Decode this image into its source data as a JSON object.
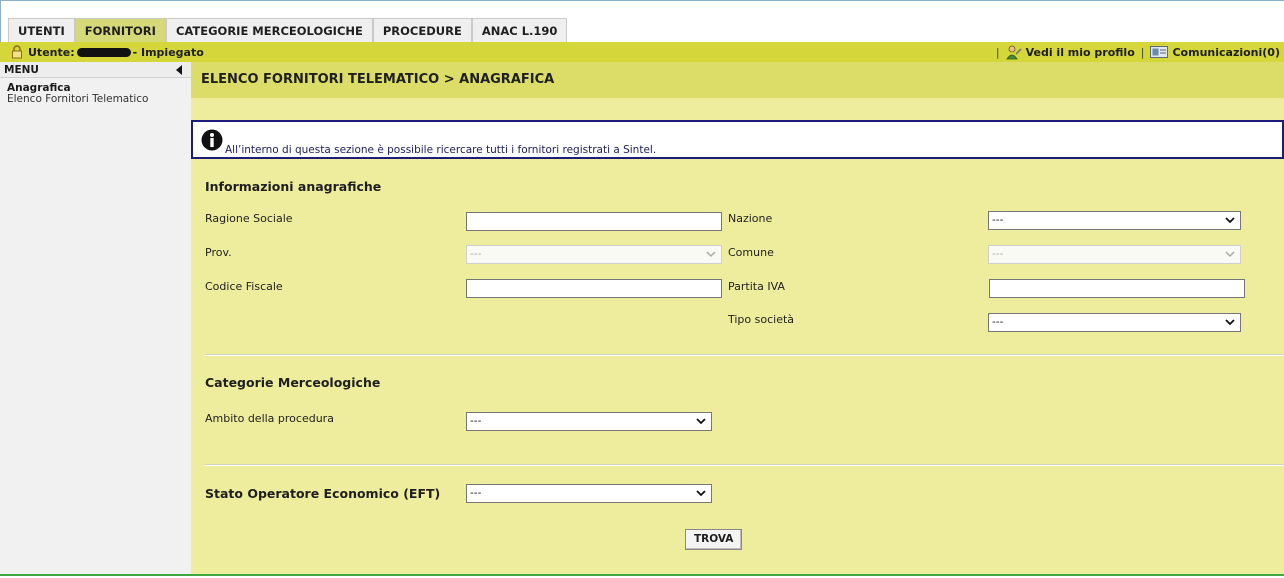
{
  "tabs": [
    {
      "label": "UTENTI",
      "active": false
    },
    {
      "label": "FORNITORI",
      "active": true
    },
    {
      "label": "CATEGORIE MERCEOLOGICHE",
      "active": false
    },
    {
      "label": "PROCEDURE",
      "active": false
    },
    {
      "label": "ANAC L.190",
      "active": false
    }
  ],
  "userbar": {
    "user_prefix": "Utente:",
    "role": "- Impiegato",
    "profile_link": "Vedi il mio profilo",
    "messages_link": "Comunicazioni(0)",
    "separator": "|"
  },
  "sidebar": {
    "menu_label": "MENU",
    "group_label": "Anagrafica",
    "item_label": "Elenco Fornitori Telematico"
  },
  "breadcrumb": "ELENCO FORNITORI TELEMATICO  > ANAGRAFICA",
  "info": {
    "text": "All’interno di questa sezione è possibile ricercare tutti i fornitori registrati a Sintel."
  },
  "form": {
    "section_anagrafica": "Informazioni anagrafiche",
    "ragione_sociale_label": "Ragione Sociale",
    "ragione_sociale_value": "",
    "nazione_label": "Nazione",
    "nazione_value": "---",
    "prov_label": "Prov.",
    "prov_value": "---",
    "comune_label": "Comune",
    "comune_value": "---",
    "codice_fiscale_label": "Codice Fiscale",
    "codice_fiscale_value": "",
    "partita_iva_label": "Partita IVA",
    "partita_iva_value": "",
    "tipo_societa_label": "Tipo società",
    "tipo_societa_value": "---",
    "section_categorie": "Categorie Merceologiche",
    "ambito_label": "Ambito della procedura",
    "ambito_value": "---",
    "stato_label": "Stato Operatore Economico (EFT)",
    "stato_value": "---",
    "search_button": "TROVA"
  },
  "colors": {
    "active_tab": "#d6d97a",
    "userbar": "#d4d63a",
    "breadcrumb_bar": "#dcdc68",
    "content_bg": "#eeed9e",
    "info_border": "#1c1c7a"
  }
}
